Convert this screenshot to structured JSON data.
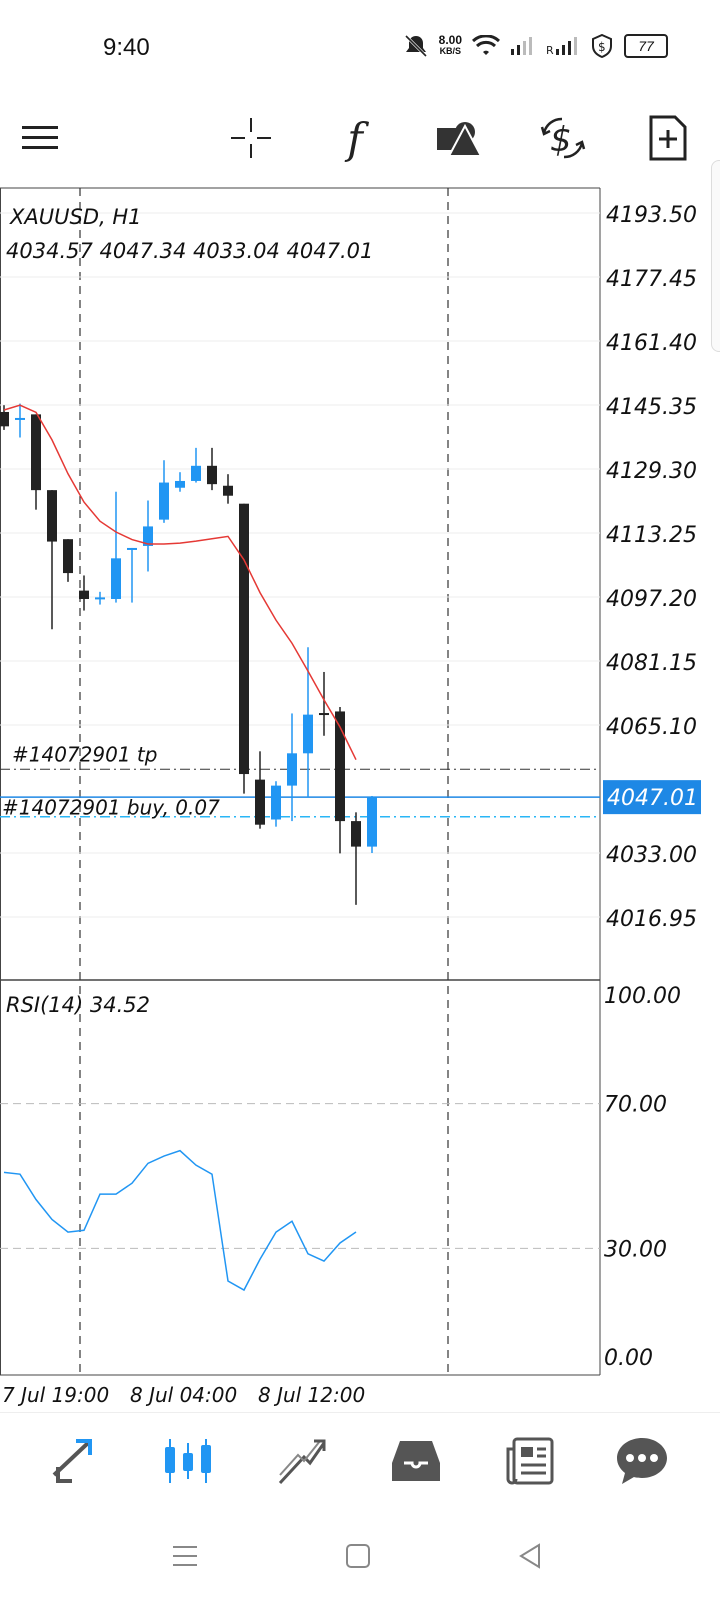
{
  "status_bar": {
    "time": "9:40",
    "net_speed_value": "8.00",
    "net_speed_unit": "KB/S",
    "battery": "77",
    "icons": [
      "mute-icon",
      "wifi-icon",
      "signal-icon",
      "signal-roaming-icon",
      "shield-dollar-icon",
      "battery-icon"
    ]
  },
  "toolbar": {
    "icons": [
      "menu-icon",
      "crosshair-icon",
      "indicators-icon",
      "objects-icon",
      "symbol-change-icon",
      "new-order-icon"
    ],
    "indicators_glyph": "f"
  },
  "chart": {
    "symbol_timeframe": "XAUUSD, H1",
    "ohlc": "4034.57 4047.34 4033.04 4047.01",
    "price_labels": [
      "4193.50",
      "4177.45",
      "4161.40",
      "4145.35",
      "4129.30",
      "4113.25",
      "4097.20",
      "4081.15",
      "4065.10",
      "4033.00",
      "4016.95"
    ],
    "current_price": "4047.01",
    "tp_label": "#14072901 tp",
    "order_label": "#14072901 buy, 0.07",
    "rsi_label": "RSI(14) 34.52",
    "rsi_levels": [
      "100.00",
      "70.00",
      "30.00",
      "0.00"
    ],
    "time_labels": [
      "7 Jul 19:00",
      "8 Jul 04:00",
      "8 Jul 12:00"
    ],
    "colors": {
      "bull": "#2196f3",
      "bear": "#222222",
      "ma": "#e53935",
      "rsi": "#2196f3",
      "price_tag": "#1e88e5"
    }
  },
  "chart_data": {
    "type": "candlestick",
    "title": "XAUUSD, H1",
    "ylim": [
      4005.0,
      4200.0
    ],
    "candles": [
      {
        "o": 4143.6,
        "h": 4145.3,
        "l": 4139.1,
        "c": 4140.0
      },
      {
        "o": 4142.1,
        "h": 4145.7,
        "l": 4137.2,
        "c": 4142.1
      },
      {
        "o": 4143.0,
        "h": 4143.0,
        "l": 4119.1,
        "c": 4124.0
      },
      {
        "o": 4124.0,
        "h": 4124.0,
        "l": 4089.1,
        "c": 4111.1
      },
      {
        "o": 4111.7,
        "h": 4111.7,
        "l": 4101.0,
        "c": 4103.2
      },
      {
        "o": 4098.8,
        "h": 4102.6,
        "l": 4093.8,
        "c": 4096.7
      },
      {
        "o": 4097.1,
        "h": 4098.5,
        "l": 4095.3,
        "c": 4097.1
      },
      {
        "o": 4096.7,
        "h": 4123.6,
        "l": 4095.8,
        "c": 4106.9
      },
      {
        "o": 4109.5,
        "h": 4109.5,
        "l": 4095.8,
        "c": 4109.5
      },
      {
        "o": 4110.0,
        "h": 4121.4,
        "l": 4103.6,
        "c": 4114.9
      },
      {
        "o": 4116.6,
        "h": 4131.5,
        "l": 4115.8,
        "c": 4125.9
      },
      {
        "o": 4124.6,
        "h": 4128.5,
        "l": 4123.6,
        "c": 4126.3
      },
      {
        "o": 4126.3,
        "h": 4134.6,
        "l": 4125.9,
        "c": 4130.1
      },
      {
        "o": 4130.1,
        "h": 4134.6,
        "l": 4124.0,
        "c": 4125.5
      },
      {
        "o": 4125.1,
        "h": 4128.0,
        "l": 4120.6,
        "c": 4122.6
      },
      {
        "o": 4120.6,
        "h": 4120.6,
        "l": 4047.9,
        "c": 4052.8
      },
      {
        "o": 4051.4,
        "h": 4058.5,
        "l": 4039.1,
        "c": 4040.1
      },
      {
        "o": 4041.4,
        "h": 4051.0,
        "l": 4039.6,
        "c": 4049.9
      },
      {
        "o": 4049.9,
        "h": 4068.0,
        "l": 4041.0,
        "c": 4058.0
      },
      {
        "o": 4058.0,
        "h": 4084.6,
        "l": 4046.9,
        "c": 4067.7
      },
      {
        "o": 4068.1,
        "h": 4078.4,
        "l": 4062.4,
        "c": 4067.7
      },
      {
        "o": 4068.5,
        "h": 4069.6,
        "l": 4032.9,
        "c": 4041.0
      },
      {
        "o": 4041.0,
        "h": 4043.2,
        "l": 4020.0,
        "c": 4034.6
      },
      {
        "o": 4034.6,
        "h": 4047.3,
        "l": 4033.0,
        "c": 4047.0
      }
    ],
    "moving_average": [
      4144.1,
      4145.3,
      4143.5,
      4136.6,
      4128.1,
      4121.0,
      4116.2,
      4113.5,
      4111.6,
      4110.5,
      4110.5,
      4110.7,
      4111.2,
      4111.8,
      4112.4,
      4106.5,
      4098.3,
      4091.4,
      4085.6,
      4078.6,
      4071.4,
      4064.6,
      4056.4
    ],
    "rsi": {
      "ylim": [
        0,
        100
      ],
      "levels": [
        30,
        70
      ],
      "values": [
        51.0,
        50.5,
        43.5,
        38.0,
        34.5,
        35.0,
        45.0,
        45.0,
        48.0,
        53.5,
        55.5,
        57.0,
        53.0,
        50.5,
        21.0,
        18.5,
        27.0,
        34.5,
        37.5,
        28.5,
        26.5,
        31.5,
        34.52
      ]
    },
    "x": [
      "7 Jul 19:00",
      "8 Jul 04:00",
      "8 Jul 12:00"
    ],
    "lines": {
      "tp": 4054.0,
      "buy": 4042.1,
      "bid": 4047.01
    }
  },
  "bottom_nav": {
    "icons": [
      "quotes-icon",
      "chart-icon",
      "trade-icon",
      "history-icon",
      "news-icon",
      "messages-icon"
    ]
  },
  "system_nav": {
    "icons": [
      "recent-apps-icon",
      "home-icon",
      "back-icon"
    ]
  }
}
